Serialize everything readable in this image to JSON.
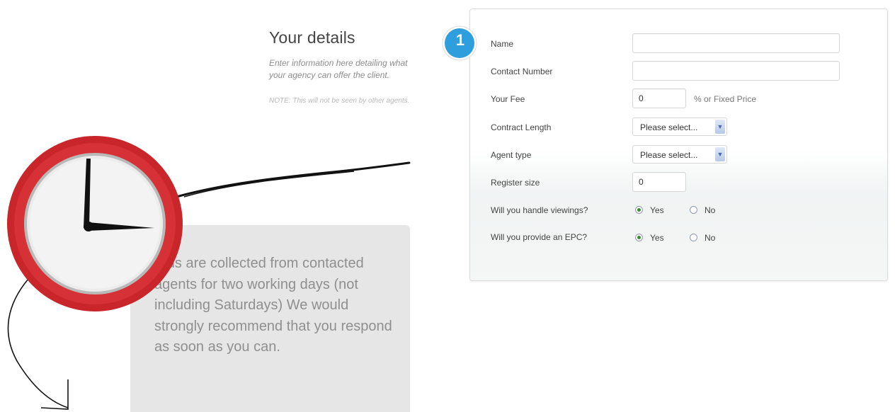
{
  "intro": {
    "title": "Your details",
    "description": "Enter information here detailing what your agency can offer the client.",
    "note": "NOTE: This will not be seen by other agents."
  },
  "info_box": {
    "text": "Bids are collected from contacted agents for two working days (not including Saturdays) We would strongly recommend that you respond as soon as you can."
  },
  "step": {
    "number": "1"
  },
  "form": {
    "name_label": "Name",
    "name_value": "",
    "contact_label": "Contact Number",
    "contact_value": "",
    "fee_label": "Your Fee",
    "fee_value": "0",
    "fee_suffix": "% or Fixed Price",
    "contract_label": "Contract Length",
    "contract_value": "Please select...",
    "agent_type_label": "Agent type",
    "agent_type_value": "Please select...",
    "register_label": "Register size",
    "register_value": "0",
    "viewings_label": "Will you handle viewings?",
    "viewings_yes": "Yes",
    "viewings_no": "No",
    "viewings_selected": "Yes",
    "epc_label": "Will you provide an EPC?",
    "epc_yes": "Yes",
    "epc_no": "No",
    "epc_selected": "Yes"
  },
  "icons": {
    "clock": "clock-icon",
    "select_arrow": "chevron-down-icon",
    "step_badge": "circle-badge"
  },
  "colors": {
    "clock_ring": "#c8262b",
    "badge": "#2e9fdc",
    "info_box": "#e6e6e6",
    "radio_checked": "#3a8a3a"
  }
}
